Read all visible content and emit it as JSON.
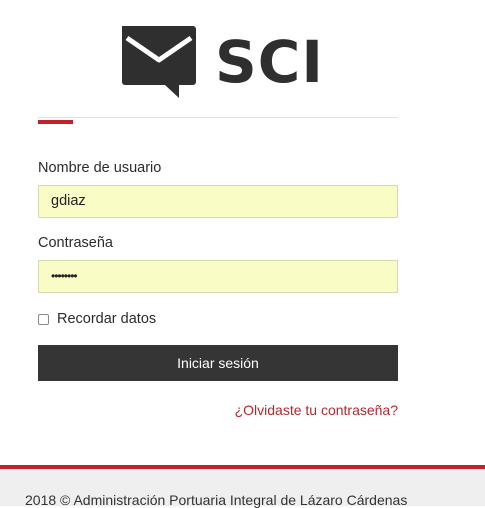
{
  "logo": {
    "icon": "mail-chat-icon",
    "text": "SCI"
  },
  "form": {
    "username_label": "Nombre de usuario",
    "username_value": "gdiaz",
    "password_label": "Contraseña",
    "password_value": "••••••••",
    "remember_label": "Recordar datos",
    "remember_checked": false,
    "submit_label": "Iniciar sesión",
    "forgot_label": "¿Olvidaste tu contraseña?"
  },
  "footer": {
    "text": "2018 © Administración Portuaria Integral de Lázaro Cárdenas"
  },
  "colors": {
    "accent": "#c0212b",
    "button": "#353535",
    "autofill": "#fafcc6"
  }
}
